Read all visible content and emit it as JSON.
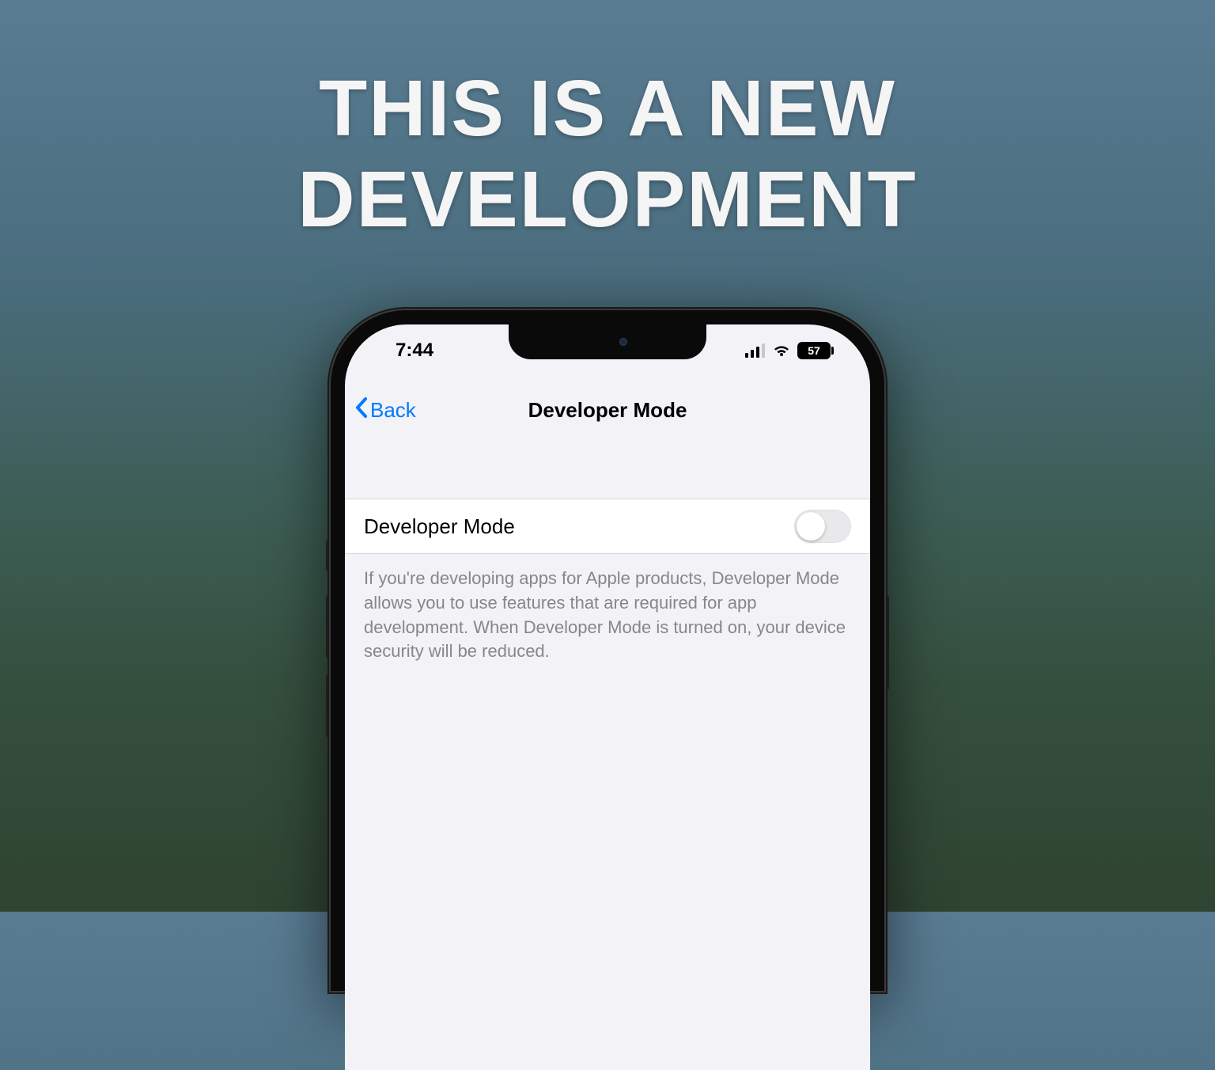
{
  "headline_line1": "THIS IS A NEW",
  "headline_line2": "DEVELOPMENT",
  "statusbar": {
    "time": "7:44",
    "battery": "57"
  },
  "nav": {
    "back_label": "Back",
    "title": "Developer Mode"
  },
  "setting": {
    "label": "Developer Mode",
    "toggle_on": false,
    "footer": "If you're developing apps for Apple products, Developer Mode allows you to use features that are required for app development. When Developer Mode is turned on, your device security will be reduced."
  }
}
